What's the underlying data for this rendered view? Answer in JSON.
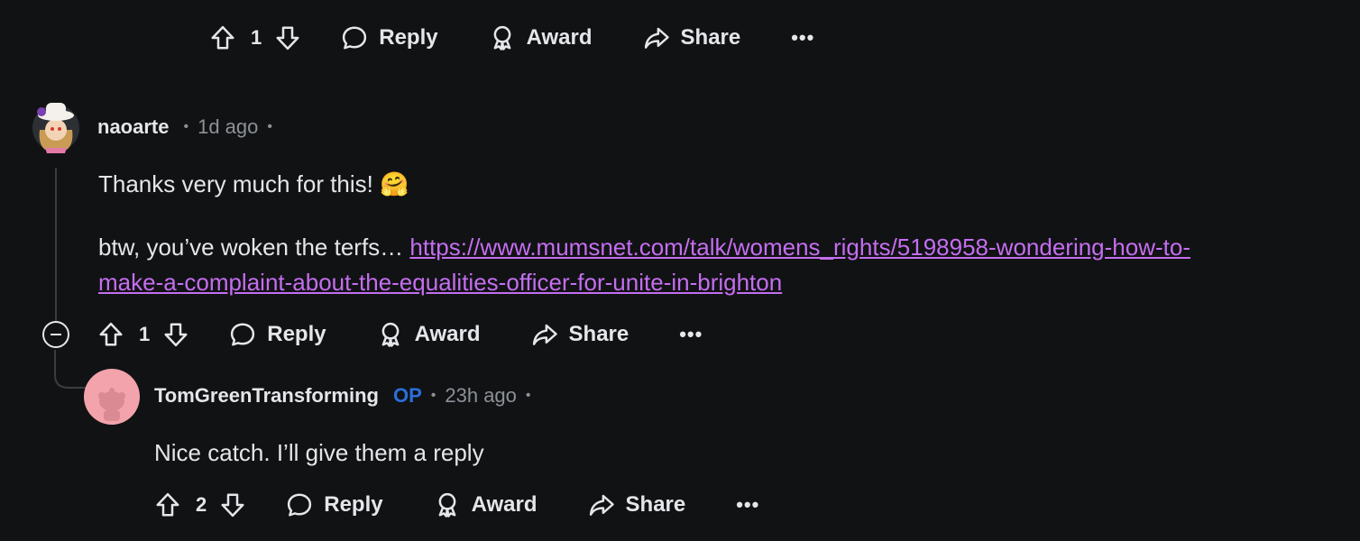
{
  "top_actions": {
    "vote_count": "1",
    "reply": "Reply",
    "award": "Award",
    "share": "Share"
  },
  "comment1": {
    "username": "naoarte",
    "time": "1d ago",
    "line1": "Thanks very much for this! 🤗",
    "line2_prefix": "btw, you’ve woken the terfs… ",
    "link_line1": "https://www.mumsnet.com/talk/womens_rights/5198958-wondering-how-to-",
    "link_line2": "make-a-complaint-about-the-equalities-officer-for-unite-in-brighton",
    "actions": {
      "vote_count": "1",
      "reply": "Reply",
      "award": "Award",
      "share": "Share"
    }
  },
  "comment2": {
    "username": "TomGreenTransforming",
    "op_badge": "OP",
    "time": "23h ago",
    "text": "Nice catch. I’ll give them a reply",
    "actions": {
      "vote_count": "2",
      "reply": "Reply",
      "award": "Award",
      "share": "Share"
    }
  },
  "colors": {
    "background": "#111214",
    "link": "#c46ef0",
    "op": "#2a6fdb"
  }
}
